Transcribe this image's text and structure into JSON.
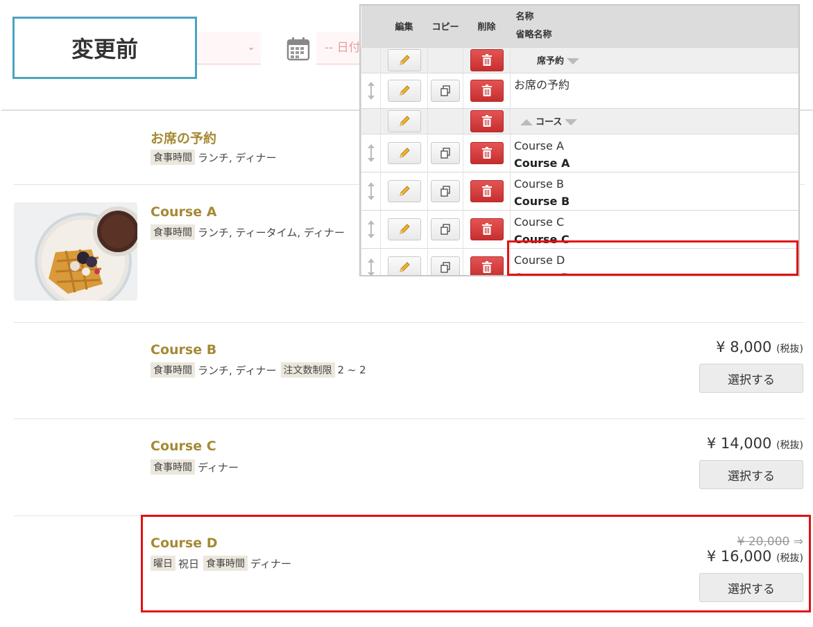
{
  "overlay_label": "変更前",
  "search": {
    "date_placeholder": "-- 日付",
    "select_chevron": "⌄"
  },
  "admin_table": {
    "headers": {
      "edit": "編集",
      "copy": "コピー",
      "delete": "削除",
      "name": "名称",
      "short_name": "省略名称"
    },
    "groups": [
      {
        "label": "席予約",
        "items": [
          {
            "name": "お席の予約",
            "short_name": ""
          }
        ]
      },
      {
        "label": "コース",
        "items": [
          {
            "name": "Course A",
            "short_name": "Course A"
          },
          {
            "name": "Course B",
            "short_name": "Course B"
          },
          {
            "name": "Course C",
            "short_name": "Course C"
          },
          {
            "name": "Course D",
            "short_name": "Course D"
          }
        ]
      }
    ]
  },
  "courses": [
    {
      "name": "お席の予約",
      "tags": [
        {
          "label": "食事時間",
          "value": "ランチ, ディナー"
        }
      ]
    },
    {
      "name": "Course A",
      "tags": [
        {
          "label": "食事時間",
          "value": "ランチ, ティータイム, ディナー"
        }
      ]
    },
    {
      "name": "Course B",
      "tags": [
        {
          "label": "食事時間",
          "value": "ランチ, ディナー"
        },
        {
          "label": "注文数制限",
          "value": "2 ~ 2"
        }
      ],
      "price": "¥ 8,000",
      "tax": "(税抜)",
      "button": "選択する"
    },
    {
      "name": "Course C",
      "tags": [
        {
          "label": "食事時間",
          "value": "ディナー"
        }
      ],
      "price": "¥ 14,000",
      "tax": "(税抜)",
      "button": "選択する"
    },
    {
      "name": "Course D",
      "tags": [
        {
          "label": "曜日",
          "value": "祝日"
        },
        {
          "label": "食事時間",
          "value": "ディナー"
        }
      ],
      "old_price": "¥ 20,000",
      "arrow": "⇒",
      "price": "¥ 16,000",
      "tax": "(税抜)",
      "button": "選択する"
    }
  ],
  "colors": {
    "course_title": "#a58934",
    "highlight": "#e41010",
    "label_border": "#4aa3c0",
    "delete_button": "#d33b3b"
  }
}
